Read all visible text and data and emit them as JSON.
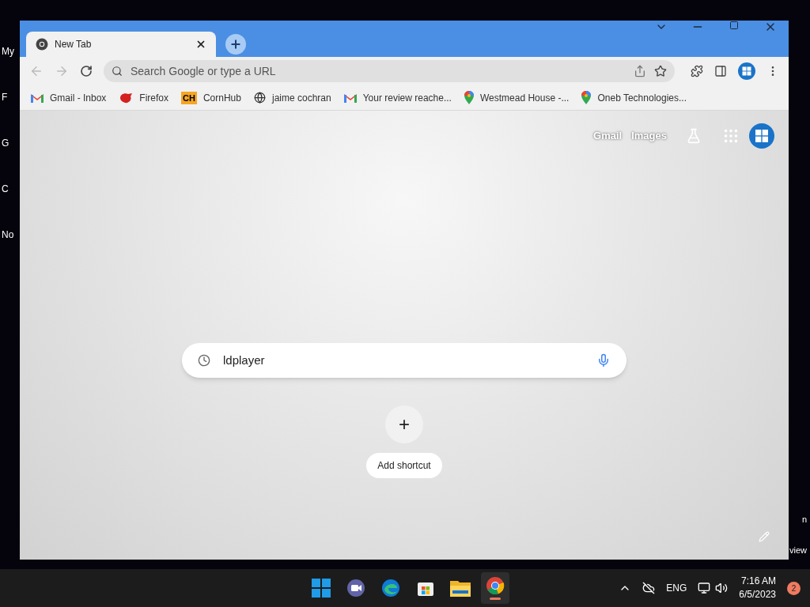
{
  "desktop": {
    "icons": [
      {
        "label": "My"
      },
      {
        "label": "F"
      },
      {
        "label": "G"
      },
      {
        "label": "C"
      },
      {
        "label": "No"
      }
    ],
    "watermark": [
      "n",
      "view"
    ]
  },
  "browser": {
    "tabs": [
      {
        "title": "New Tab",
        "selected": true
      }
    ],
    "address_bar": {
      "placeholder": "Search Google or type a URL"
    },
    "bookmarks": [
      {
        "kind": "gmail",
        "label": "Gmail - Inbox"
      },
      {
        "kind": "firefox",
        "label": "Firefox"
      },
      {
        "kind": "ch",
        "label": "CornHub",
        "icon_text": "CH"
      },
      {
        "kind": "globe",
        "label": "jaime cochran"
      },
      {
        "kind": "gmail",
        "label": "Your review reache..."
      },
      {
        "kind": "maps",
        "label": "Westmead House -..."
      },
      {
        "kind": "maps",
        "label": "Oneb Technologies..."
      }
    ],
    "top_links": [
      "Gmail",
      "Images"
    ],
    "search": {
      "value": "ldplayer"
    },
    "shortcut": {
      "icon": "+",
      "label": "Add shortcut"
    }
  },
  "taskbar": {
    "apps": [
      {
        "kind": "start",
        "active": false
      },
      {
        "kind": "chat",
        "active": false
      },
      {
        "kind": "edge",
        "active": false
      },
      {
        "kind": "store",
        "active": false
      },
      {
        "kind": "files",
        "active": false
      },
      {
        "kind": "chrome",
        "active": true
      }
    ],
    "language": "ENG",
    "time": "7:16 AM",
    "date": "6/5/2023",
    "notifications": "2"
  }
}
